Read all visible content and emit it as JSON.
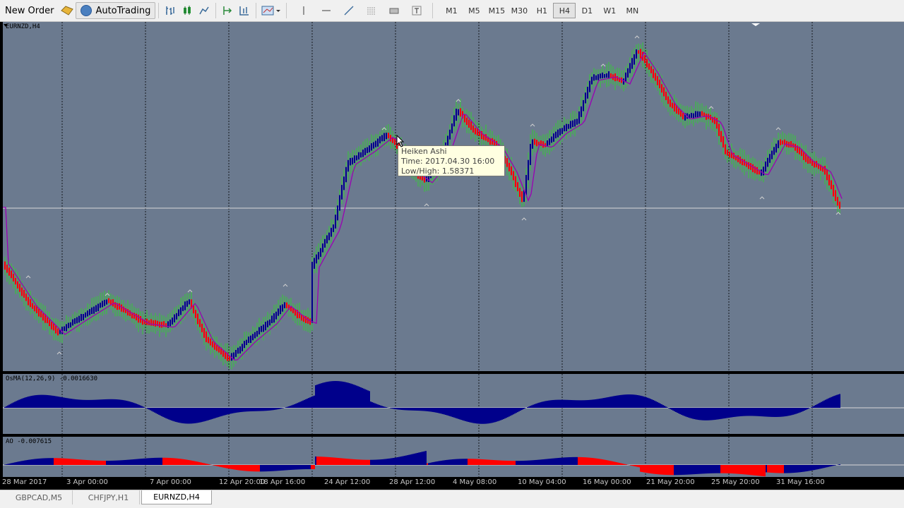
{
  "toolbar": {
    "new_order": "New Order",
    "autotrading": "AutoTrading",
    "timeframes": [
      "M1",
      "M5",
      "M15",
      "M30",
      "H1",
      "H4",
      "D1",
      "W1",
      "MN"
    ],
    "active_timeframe": "H4"
  },
  "chart": {
    "symbol_label": "EURNZD,H4",
    "osma_label": "OsMA(12,26,9) -0.0016630",
    "ao_label": "AO -0.007615",
    "colors": {
      "background": "#6b7a8f",
      "bull_candle": "#00008b",
      "bear_candle": "#ff0000",
      "wick": "#32cd32",
      "ma_line": "#9b00b4",
      "histogram": "#00008b",
      "grid": "#000000"
    }
  },
  "tooltip": {
    "line1": "Heiken Ashi",
    "line2": "Time: 2017.04.30 16:00",
    "line3": "Low/High: 1.58371"
  },
  "time_axis": [
    "28 Mar 2017",
    "3 Apr 00:00",
    "7 Apr 00:00",
    "12 Apr 20:00",
    "18 Apr 16:00",
    "24 Apr 12:00",
    "28 Apr 12:00",
    "4 May 08:00",
    "10 May 04:00",
    "16 May 00:00",
    "21 May 20:00",
    "25 May 20:00",
    "31 May 16:00"
  ],
  "tabs": [
    "GBPCAD,M5",
    "CHFJPY,H1",
    "EURNZD,H4"
  ],
  "active_tab": "EURNZD,H4"
}
